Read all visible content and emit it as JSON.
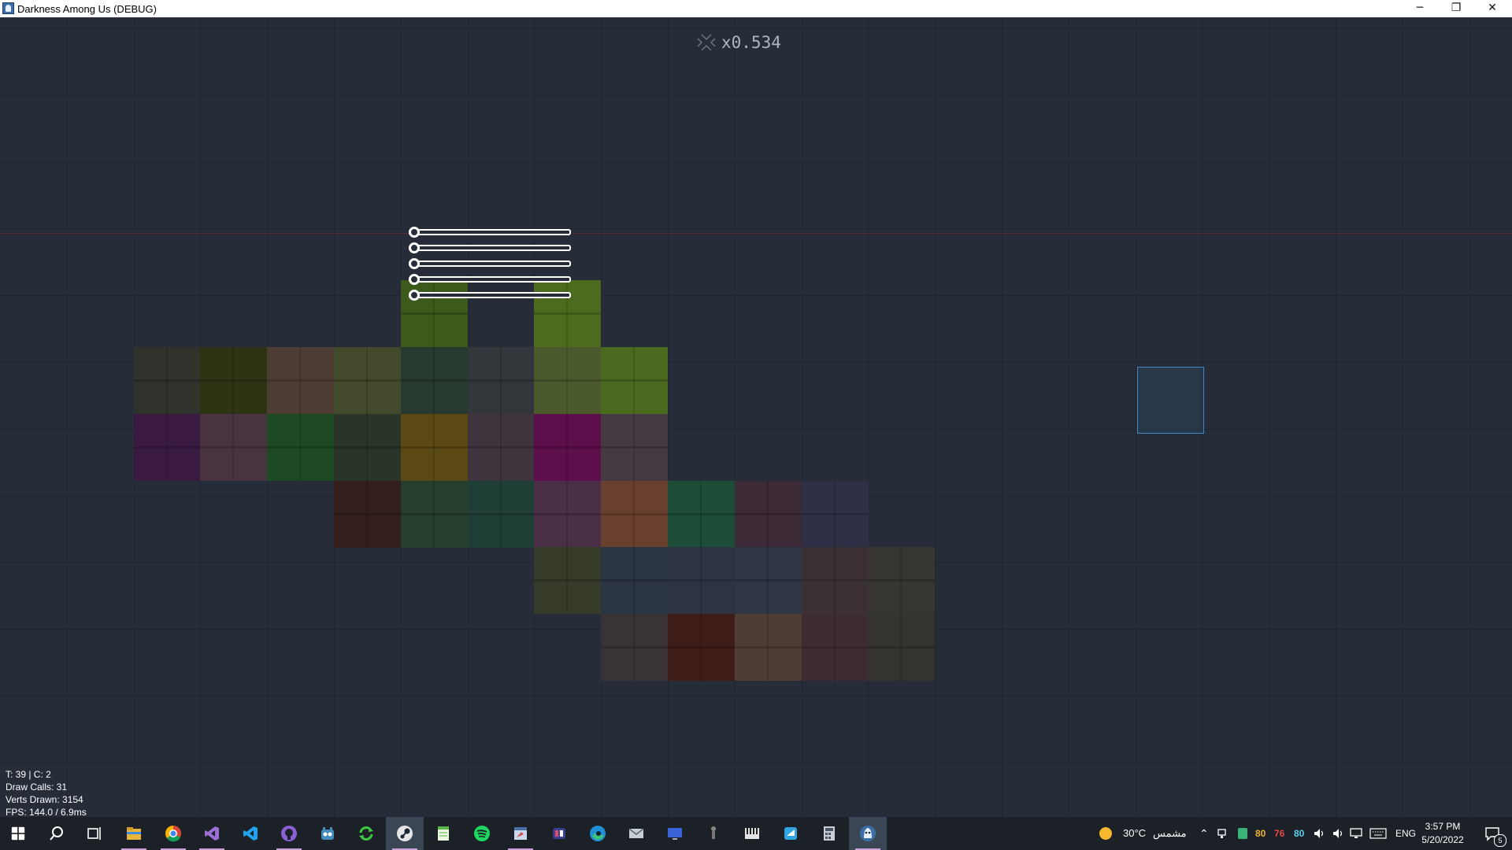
{
  "window": {
    "title": "Darkness Among Us (DEBUG)",
    "minimize_glyph": "─",
    "restore_glyph": "❐",
    "close_glyph": "✕"
  },
  "hud": {
    "zoom_label": "x0.534"
  },
  "debug_stats": {
    "line1": "T: 39 | C: 2",
    "line2": "Draw Calls: 31",
    "line3": "Verts Drawn: 3154",
    "line4": "FPS: 144.0 / 6.9ms"
  },
  "sliders": [
    {
      "name": "slider-1",
      "value": 0
    },
    {
      "name": "slider-2",
      "value": 0
    },
    {
      "name": "slider-3",
      "value": 0
    },
    {
      "name": "slider-4",
      "value": 0
    },
    {
      "name": "slider-5",
      "value": 0
    }
  ],
  "colors": {
    "background": "#262d38",
    "grid": "#1f252e",
    "selection": "#3d88c9",
    "taskbar": "#1b2127"
  },
  "taskbar": {
    "apps": [
      {
        "name": "start",
        "icon": "windows-icon"
      },
      {
        "name": "search",
        "icon": "search-icon"
      },
      {
        "name": "task-view",
        "icon": "task-view-icon"
      },
      {
        "name": "file-explorer",
        "icon": "folder-icon"
      },
      {
        "name": "chrome",
        "icon": "chrome-icon"
      },
      {
        "name": "visual-studio",
        "icon": "visual-studio-icon"
      },
      {
        "name": "vscode",
        "icon": "vscode-icon"
      },
      {
        "name": "github-desktop",
        "icon": "github-icon"
      },
      {
        "name": "godot",
        "icon": "godot-icon"
      },
      {
        "name": "sync",
        "icon": "sync-icon"
      },
      {
        "name": "steam",
        "icon": "steam-icon"
      },
      {
        "name": "notepad",
        "icon": "notepad-icon"
      },
      {
        "name": "spotify",
        "icon": "spotify-icon"
      },
      {
        "name": "paint",
        "icon": "paint-icon"
      },
      {
        "name": "discord",
        "icon": "discord-icon"
      },
      {
        "name": "edge",
        "icon": "edge-icon"
      },
      {
        "name": "mail",
        "icon": "mail-icon"
      },
      {
        "name": "remote-desktop",
        "icon": "monitor-icon"
      },
      {
        "name": "game-character",
        "icon": "character-icon"
      },
      {
        "name": "audio-editor",
        "icon": "piano-icon"
      },
      {
        "name": "screen-sketch",
        "icon": "snip-icon"
      },
      {
        "name": "calculator",
        "icon": "calculator-icon"
      },
      {
        "name": "darkness-among-us",
        "icon": "game-icon"
      }
    ],
    "weather_temp": "30°C",
    "weather_text": "مشمس",
    "tray_num_1": "80",
    "tray_num_2": "76",
    "tray_num_3": "80",
    "language": "ENG",
    "time": "3:57 PM",
    "date": "5/20/2022",
    "notification_count": "5"
  }
}
